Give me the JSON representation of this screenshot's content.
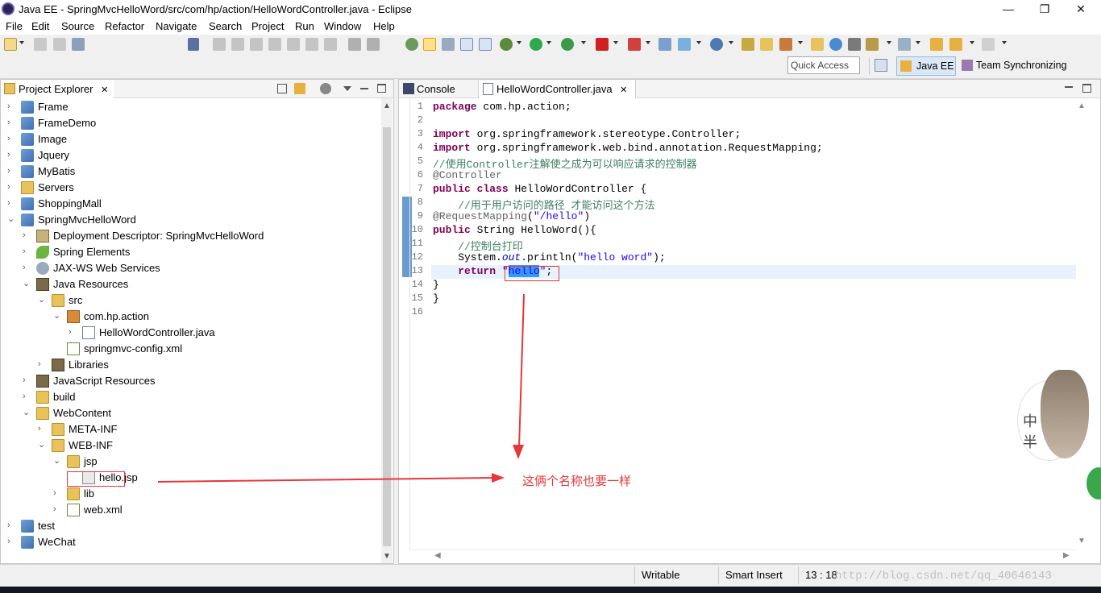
{
  "window": {
    "title": "Java EE - SpringMvcHelloWord/src/com/hp/action/HelloWordController.java - Eclipse",
    "minimize": "—",
    "restore": "❐",
    "close": "✕"
  },
  "menu": [
    "File",
    "Edit",
    "Source",
    "Refactor",
    "Navigate",
    "Search",
    "Project",
    "Run",
    "Window",
    "Help"
  ],
  "quick_access": {
    "placeholder": "Quick Access"
  },
  "perspectives": [
    "Java EE",
    "Team Synchronizing"
  ],
  "explorer": {
    "tab_label": "Project Explorer",
    "tab_close": "✕",
    "tree": [
      {
        "label": "Frame",
        "depth": 0,
        "twisty": "›",
        "icon": "project-icon"
      },
      {
        "label": "FrameDemo",
        "depth": 0,
        "twisty": "›",
        "icon": "project-icon"
      },
      {
        "label": "Image",
        "depth": 0,
        "twisty": "›",
        "icon": "project-icon"
      },
      {
        "label": "Jquery",
        "depth": 0,
        "twisty": "›",
        "icon": "project-icon"
      },
      {
        "label": "MyBatis",
        "depth": 0,
        "twisty": "›",
        "icon": "project-icon"
      },
      {
        "label": "Servers",
        "depth": 0,
        "twisty": "›",
        "icon": "folder-icon"
      },
      {
        "label": "ShoppingMall",
        "depth": 0,
        "twisty": "›",
        "icon": "project-icon"
      },
      {
        "label": "SpringMvcHelloWord",
        "depth": 0,
        "twisty": "⌄",
        "icon": "project-icon"
      },
      {
        "label": "Deployment Descriptor: SpringMvcHelloWord",
        "depth": 1,
        "twisty": "›",
        "icon": "deployment-descriptor-icon"
      },
      {
        "label": "Spring Elements",
        "depth": 1,
        "twisty": "›",
        "icon": "spring-icon"
      },
      {
        "label": "JAX-WS Web Services",
        "depth": 1,
        "twisty": "›",
        "icon": "web-services-icon"
      },
      {
        "label": "Java Resources",
        "depth": 1,
        "twisty": "⌄",
        "icon": "java-resources-icon"
      },
      {
        "label": "src",
        "depth": 2,
        "twisty": "⌄",
        "icon": "source-folder-icon"
      },
      {
        "label": "com.hp.action",
        "depth": 3,
        "twisty": "⌄",
        "icon": "package-icon"
      },
      {
        "label": "HelloWordController.java",
        "depth": 4,
        "twisty": "›",
        "icon": "java-file-icon"
      },
      {
        "label": "springmvc-config.xml",
        "depth": 3,
        "twisty": "",
        "icon": "xml-file-icon"
      },
      {
        "label": "Libraries",
        "depth": 2,
        "twisty": "›",
        "icon": "library-icon"
      },
      {
        "label": "JavaScript Resources",
        "depth": 1,
        "twisty": "›",
        "icon": "js-resources-icon"
      },
      {
        "label": "build",
        "depth": 1,
        "twisty": "›",
        "icon": "folder-icon"
      },
      {
        "label": "WebContent",
        "depth": 1,
        "twisty": "⌄",
        "icon": "folder-icon"
      },
      {
        "label": "META-INF",
        "depth": 2,
        "twisty": "›",
        "icon": "folder-icon"
      },
      {
        "label": "WEB-INF",
        "depth": 2,
        "twisty": "⌄",
        "icon": "folder-icon"
      },
      {
        "label": "jsp",
        "depth": 3,
        "twisty": "⌄",
        "icon": "folder-icon"
      },
      {
        "label": "hello.jsp",
        "depth": 4,
        "twisty": "",
        "icon": "jsp-file-icon"
      },
      {
        "label": "lib",
        "depth": 3,
        "twisty": "›",
        "icon": "folder-icon"
      },
      {
        "label": "web.xml",
        "depth": 3,
        "twisty": "›",
        "icon": "xml-file-icon"
      },
      {
        "label": "test",
        "depth": 0,
        "twisty": "›",
        "icon": "project-icon"
      },
      {
        "label": "WeChat",
        "depth": 0,
        "twisty": "›",
        "icon": "project-icon"
      }
    ]
  },
  "editor": {
    "tabs": [
      {
        "label": "Console",
        "icon": "console-icon",
        "active": false
      },
      {
        "label": "HelloWordController.java",
        "icon": "java-file-icon",
        "active": true,
        "close": "✕"
      }
    ],
    "line_numbers": [
      "1",
      "2",
      "3",
      "4",
      "5",
      "6",
      "7",
      "8",
      "9",
      "10",
      "11",
      "12",
      "13",
      "14",
      "15",
      "16"
    ],
    "code": [
      [
        {
          "t": "package",
          "c": "kw"
        },
        {
          "t": " com.hp.action;",
          "c": ""
        }
      ],
      [],
      [
        {
          "t": "import",
          "c": "kw"
        },
        {
          "t": " org.springframework.stereotype.Controller;",
          "c": ""
        }
      ],
      [
        {
          "t": "import",
          "c": "kw"
        },
        {
          "t": " org.springframework.web.bind.annotation.RequestMapping;",
          "c": ""
        }
      ],
      [
        {
          "t": "//使用Controller注解使之成为可以响应请求的控制器",
          "c": "cm"
        }
      ],
      [
        {
          "t": "@Controller",
          "c": "ann"
        }
      ],
      [
        {
          "t": "public",
          "c": "kw"
        },
        {
          "t": " ",
          "c": ""
        },
        {
          "t": "class",
          "c": "kw"
        },
        {
          "t": " HelloWordController {",
          "c": ""
        }
      ],
      [
        {
          "t": "    //用于用户访问的路径 才能访问这个方法",
          "c": "cm"
        }
      ],
      [
        {
          "t": "@RequestMapping",
          "c": "ann"
        },
        {
          "t": "(",
          "c": ""
        },
        {
          "t": "\"/hello\"",
          "c": "str"
        },
        {
          "t": ")",
          "c": ""
        }
      ],
      [
        {
          "t": "public",
          "c": "kw"
        },
        {
          "t": " String HelloWord(){",
          "c": ""
        }
      ],
      [
        {
          "t": "    //控制台打印",
          "c": "cm"
        }
      ],
      [
        {
          "t": "    System.",
          "c": ""
        },
        {
          "t": "out",
          "c": "fld"
        },
        {
          "t": ".println(",
          "c": ""
        },
        {
          "t": "\"hello word\"",
          "c": "str"
        },
        {
          "t": ");",
          "c": ""
        }
      ],
      [
        {
          "t": "    ",
          "c": ""
        },
        {
          "t": "return",
          "c": "kw"
        },
        {
          "t": " ",
          "c": ""
        },
        {
          "t": "\"hello\"",
          "c": "str"
        },
        {
          "t": ";",
          "c": ""
        }
      ],
      [
        {
          "t": "}",
          "c": ""
        }
      ],
      [
        {
          "t": "}",
          "c": ""
        }
      ],
      []
    ]
  },
  "annotation": {
    "text": "这俩个名称也要一样"
  },
  "status": {
    "writable": "Writable",
    "insert_mode": "Smart Insert",
    "position": "13 : 18"
  },
  "watermark": "http://blog.csdn.net/qq_40646143",
  "colors": {
    "keyword": "#7f0055",
    "comment": "#3f7f5f",
    "string": "#2a00ff",
    "annotation_arrow": "#e8363a",
    "current_line": "#e8f2fe",
    "selection": "#3399ff"
  }
}
